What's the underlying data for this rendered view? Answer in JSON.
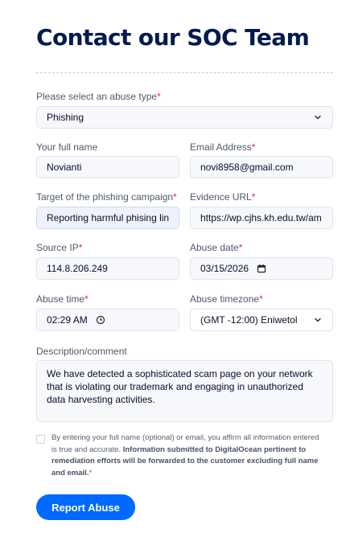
{
  "page": {
    "title": "Contact our SOC Team"
  },
  "form": {
    "abuse_type": {
      "label": "Please select an abuse type",
      "value": "Phishing"
    },
    "full_name": {
      "label": "Your full name",
      "value": "Novianti"
    },
    "email": {
      "label": "Email Address",
      "value": "novi8958@gmail.com"
    },
    "target": {
      "label": "Target of the phishing campaign",
      "value": "Reporting harmful phising lin"
    },
    "evidence_url": {
      "label": "Evidence URL",
      "value": "https://wp.cjhs.kh.edu.tw/am"
    },
    "source_ip": {
      "label": "Source IP",
      "value": "114.8.206.249"
    },
    "abuse_date": {
      "label": "Abuse date",
      "value": "03/15/2026"
    },
    "abuse_time": {
      "label": "Abuse time",
      "value": "02:29 AM"
    },
    "timezone": {
      "label": "Abuse timezone",
      "value": "(GMT -12:00) Eniwetol"
    },
    "description": {
      "label": "Description/comment",
      "value": "We have detected a sophisticated scam page on your network that is violating our trademark and engaging in unauthorized data harvesting activities."
    },
    "consent": {
      "text": "By entering your full name (optional) or email, you affirm all information entered is true and accurate.",
      "bold": "Information submitted to DigitalOcean pertinent to remediation efforts will be forwarded to the customer excluding full name and email.",
      "checked": false
    },
    "required_marker": "*",
    "submit_label": "Report Abuse"
  },
  "colors": {
    "accent": "#0069ff",
    "required": "#e0284a",
    "title": "#031b4e"
  },
  "icons": {
    "select": "chevron-down-icon",
    "date": "calendar-icon",
    "time": "clock-icon"
  }
}
